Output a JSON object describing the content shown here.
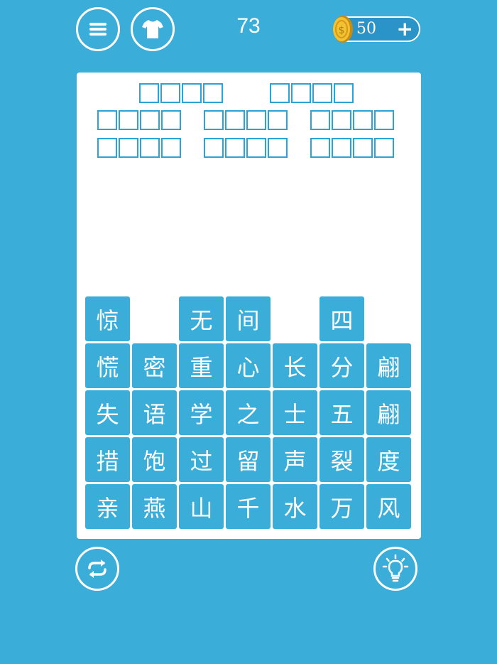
{
  "header": {
    "level": "73",
    "coins": "50",
    "plus": "+"
  },
  "colors": {
    "background": "#3aadd9",
    "tile": "#3aadd9",
    "slot_border": "#2ba3d5",
    "coin": "#f1c232"
  },
  "answer_slots": {
    "row1": [
      4,
      4
    ],
    "row2": [
      4,
      4,
      4
    ],
    "row3": [
      4,
      4,
      4
    ]
  },
  "tiles": [
    [
      "惊",
      "",
      "无",
      "间",
      "",
      "四",
      ""
    ],
    [
      "慌",
      "密",
      "重",
      "心",
      "长",
      "分",
      "翩"
    ],
    [
      "失",
      "语",
      "学",
      "之",
      "士",
      "五",
      "翩"
    ],
    [
      "措",
      "饱",
      "过",
      "留",
      "声",
      "裂",
      "度"
    ],
    [
      "亲",
      "燕",
      "山",
      "千",
      "水",
      "万",
      "风"
    ]
  ],
  "icons": [
    "menu-icon",
    "shirt-icon",
    "coin-icon",
    "plus-icon",
    "refresh-icon",
    "lightbulb-icon"
  ]
}
